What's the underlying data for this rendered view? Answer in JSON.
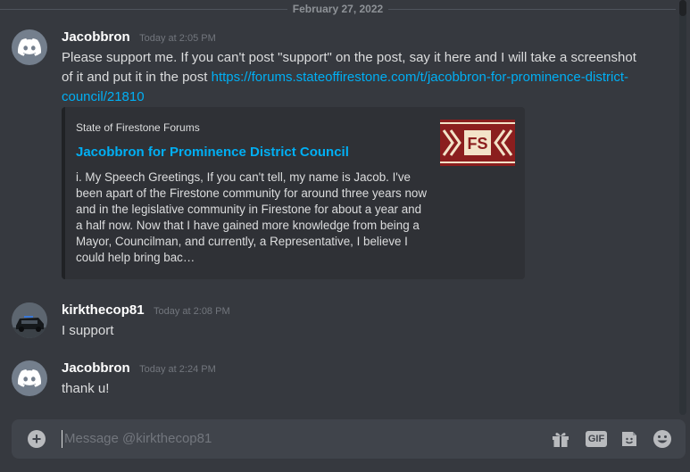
{
  "date_divider": "February 27, 2022",
  "messages": [
    {
      "username": "Jacobbron",
      "timestamp": "Today at 2:05 PM",
      "text": "Please support me. If you can't post \"support\" on the post, say it here and I will take a screenshot of it and put it in the post ",
      "link": "https://forums.stateoffirestone.com/t/jacobbron-for-prominence-district-council/21810",
      "embed": {
        "provider": "State of Firestone Forums",
        "title": "Jacobbron for Prominence District Council",
        "description": "i. My Speech Greetings, If you can't tell, my name is Jacob. I've been apart of the Firestone community for around three years now and in the legislative community in Firestone for about a year and a half now. Now that I have gained more knowledge from being a Mayor, Councilman, and currently, a Representative, I believe I could help bring bac…",
        "thumbnail_text": "FS",
        "thumbnail_colors": {
          "bg": "#8b1e1e",
          "accent": "#f3e3c8"
        }
      }
    },
    {
      "username": "kirkthecop81",
      "timestamp": "Today at 2:08 PM",
      "text": "I support"
    },
    {
      "username": "Jacobbron",
      "timestamp": "Today at 2:24 PM",
      "text": "thank u!"
    }
  ],
  "composer": {
    "placeholder": "Message @kirkthecop81",
    "gif_label": "GIF",
    "icons": [
      "plus-circle-icon",
      "gift-icon",
      "gif-icon",
      "sticker-icon",
      "emoji-icon"
    ]
  },
  "colors": {
    "background": "#36393f",
    "link": "#00aff4",
    "username": "#ffffff",
    "timestamp": "#72767d"
  }
}
